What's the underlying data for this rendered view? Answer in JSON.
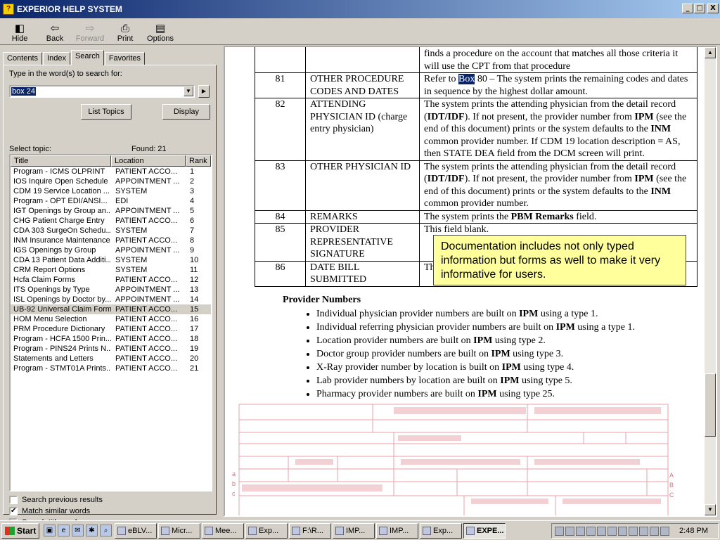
{
  "window": {
    "title": "EXPERIOR HELP SYSTEM",
    "controls": [
      "_",
      "□",
      "X"
    ]
  },
  "toolbar": {
    "buttons": [
      {
        "label": "Hide",
        "icon": "hide-icon",
        "glyph": "◧",
        "enabled": true
      },
      {
        "label": "Back",
        "icon": "back-icon",
        "glyph": "⇦",
        "enabled": true
      },
      {
        "label": "Forward",
        "icon": "forward-icon",
        "glyph": "⇨",
        "enabled": false
      },
      {
        "label": "Print",
        "icon": "print-icon",
        "glyph": "⎙",
        "enabled": true
      },
      {
        "label": "Options",
        "icon": "options-icon",
        "glyph": "▤",
        "enabled": true
      }
    ]
  },
  "nav": {
    "tabs": [
      "Contents",
      "Index",
      "Search",
      "Favorites"
    ],
    "active_tab": "Search",
    "prompt": "Type in the word(s) to search for:",
    "search_value": "box 24",
    "list_topics_label": "List Topics",
    "display_label": "Display",
    "select_topic_label": "Select topic:",
    "found_label": "Found: 21",
    "columns": [
      "Title",
      "Location",
      "Rank"
    ],
    "results": [
      {
        "title": "Program - ICMS OLPRINT",
        "location": "PATIENT ACCO...",
        "rank": "1"
      },
      {
        "title": "IOS Inquire Open Schedule",
        "location": "APPOINTMENT ...",
        "rank": "2"
      },
      {
        "title": "CDM 19 Service Location ...",
        "location": "SYSTEM",
        "rank": "3"
      },
      {
        "title": "Program - OPT EDI/ANSI...",
        "location": "EDI",
        "rank": "4"
      },
      {
        "title": "IGT Openings by Group an...",
        "location": "APPOINTMENT ...",
        "rank": "5"
      },
      {
        "title": "CHG Patient Charge Entry",
        "location": "PATIENT ACCO...",
        "rank": "6"
      },
      {
        "title": "CDA 303 SurgeOn Schedu...",
        "location": "SYSTEM",
        "rank": "7"
      },
      {
        "title": "INM Insurance Maintenance",
        "location": "PATIENT ACCO...",
        "rank": "8"
      },
      {
        "title": "IGS Openings by Group",
        "location": "APPOINTMENT ...",
        "rank": "9"
      },
      {
        "title": "CDA 13 Patient Data Additi...",
        "location": "SYSTEM",
        "rank": "10"
      },
      {
        "title": "CRM Report Options",
        "location": "SYSTEM",
        "rank": "11"
      },
      {
        "title": "Hcfa Claim Forms",
        "location": "PATIENT ACCO...",
        "rank": "12"
      },
      {
        "title": "ITS Openings by Type",
        "location": "APPOINTMENT ...",
        "rank": "13"
      },
      {
        "title": "ISL Openings by Doctor by...",
        "location": "APPOINTMENT ...",
        "rank": "14"
      },
      {
        "title": "UB-92 Universal Claim Form",
        "location": "PATIENT ACCO...",
        "rank": "15",
        "selected": true
      },
      {
        "title": "HOM Menu Selection",
        "location": "PATIENT ACCO...",
        "rank": "16"
      },
      {
        "title": "PRM Procedure Dictionary",
        "location": "PATIENT ACCO...",
        "rank": "17"
      },
      {
        "title": "Program - HCFA 1500 Prin...",
        "location": "PATIENT ACCO...",
        "rank": "18"
      },
      {
        "title": "Program - PINS24 Prints N...",
        "location": "PATIENT ACCO...",
        "rank": "19"
      },
      {
        "title": "Statements and Letters",
        "location": "PATIENT ACCO...",
        "rank": "20"
      },
      {
        "title": "Program - STMT01A Prints...",
        "location": "PATIENT ACCO...",
        "rank": "21"
      }
    ],
    "options": [
      {
        "label": "Search previous results",
        "checked": false
      },
      {
        "label": "Match similar words",
        "checked": true
      },
      {
        "label": "Search titles only",
        "checked": false
      }
    ]
  },
  "doc": {
    "row0_desc": "finds a procedure on the account that matches all those criteria it will use the CPT from that procedure",
    "row81": {
      "num": "81",
      "field": "OTHER PROCEDURE CODES AND DATES",
      "desc_pre": "Refer to ",
      "desc_hl": "Box",
      "desc_post": " 80 – The system prints the remaining codes and dates in sequence by the highest dollar amount."
    },
    "row82": {
      "num": "82",
      "field": "ATTENDING PHYSICIAN ID (charge entry physician)",
      "d1": "The system prints the attending physician from the detail record (",
      "b1": "IDT/IDF",
      "d2": "). If not present, the provider number from ",
      "b2": "IPM",
      "d3": " (see the end of this document) prints or the system defaults to the ",
      "b3": "INM",
      "d4": " common provider number.  If CDM 19 location description = AS, then STATE DEA field from the DCM screen will print."
    },
    "row83": {
      "num": "83",
      "field": "OTHER PHYSICIAN ID",
      "d1": "The system prints the attending physician from the detail record (",
      "b1": "IDT/IDF",
      "d2": "). If not present, the provider number from ",
      "b2": "IPM",
      "d3": " (see the end of this document) prints or the system defaults to the ",
      "b3": "INM",
      "d4": " common provider number."
    },
    "row84": {
      "num": "84",
      "field": "REMARKS",
      "d1": "The system prints the ",
      "b1": "PBM Remarks",
      "d2": " field."
    },
    "row85": {
      "num": "85",
      "field": "PROVIDER REPRESENTATIVE SIGNATURE",
      "desc": "This field blank."
    },
    "row86": {
      "num": "86",
      "field": "DATE BILL SUBMITTED",
      "desc": "Th"
    },
    "provider_title": "Provider Numbers",
    "provider_items": [
      {
        "pre": "Individual physician provider numbers are built on ",
        "b": "IPM",
        "post": " using a type 1."
      },
      {
        "pre": "Individual referring physician provider numbers are built on ",
        "b": "IPM",
        "post": " using a type 1."
      },
      {
        "pre": "Location provider numbers are built on ",
        "b": "IPM",
        "post": " using type 2."
      },
      {
        "pre": "Doctor group provider numbers are built on ",
        "b": "IPM",
        "post": " using type 3."
      },
      {
        "pre": "X-Ray provider number by location is built on ",
        "b": "IPM",
        "post": " using type 4."
      },
      {
        "pre": "Lab provider numbers by location are built on ",
        "b": "IPM",
        "post": " using type 5."
      },
      {
        "pre": "Pharmacy provider numbers are built on ",
        "b": "IPM",
        "post": " using type 25."
      }
    ],
    "callout": "Documentation includes not only typed information but forms as well to make it very informative for users."
  },
  "form_image": {
    "row_letters": [
      "a",
      "b",
      "c",
      "A",
      "B",
      "C"
    ]
  },
  "taskbar": {
    "start": "Start",
    "tasks": [
      "eBLV...",
      "Micr...",
      "Mee...",
      "Exp...",
      "F:\\R...",
      "IMP...",
      "IMP...",
      "Exp...",
      "EXPE..."
    ],
    "active_task": 8,
    "clock": "2:48 PM"
  },
  "colors": {
    "title_gradient_start": "#0a246a",
    "title_gradient_end": "#a6caf0",
    "face": "#d4d0c8",
    "callout_bg": "#ffff9c",
    "form_red": "#e8a0a8"
  }
}
